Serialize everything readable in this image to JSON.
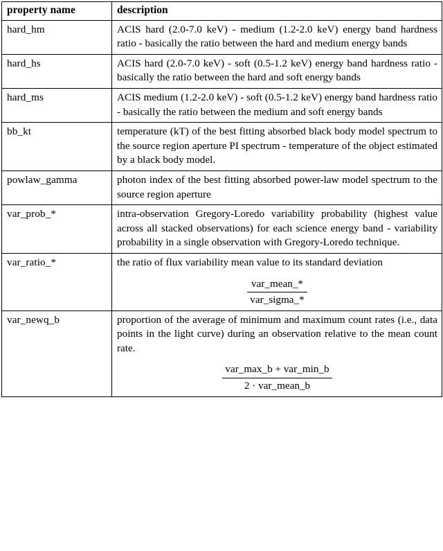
{
  "table": {
    "headers": {
      "property_name": "property name",
      "description": "description"
    },
    "rows": [
      {
        "name": "hard_hm",
        "description": "ACIS hard (2.0-7.0 keV) - medium (1.2-2.0 keV) energy band hardness ratio - basically the ratio between the hard and medium energy bands"
      },
      {
        "name": "hard_hs",
        "description": "ACIS hard (2.0-7.0 keV) - soft (0.5-1.2 keV) energy band hardness ratio - basically the ratio between the hard and soft energy bands"
      },
      {
        "name": "hard_ms",
        "description": "ACIS medium (1.2-2.0 keV) - soft (0.5-1.2 keV) energy band hardness ratio - basically the ratio between the medium and soft energy bands"
      },
      {
        "name": "bb_kt",
        "description": "temperature (kT) of the best fitting absorbed black body model spectrum to the source region aperture PI spectrum - temperature of the object estimated by a black body model."
      },
      {
        "name": "powlaw_gamma",
        "description": "photon index of the best fitting absorbed power-law model spectrum to the source region aperture"
      },
      {
        "name": "var_prob_*",
        "description": "intra-observation Gregory-Loredo variability probability (highest value across all stacked observations) for each science energy band - variability probability in a single observation with Gregory-Loredo technique."
      },
      {
        "name": "var_ratio_*",
        "description": "the ratio of flux variability mean value to its standard deviation",
        "formula": {
          "numerator": "var_mean_*",
          "denominator": "var_sigma_*"
        }
      },
      {
        "name": "var_newq_b",
        "description": "proportion of the average of minimum and maximum count rates (i.e., data points in the light curve) during an observation relative to the mean count rate.",
        "formula": {
          "numerator": "var_max_b + var_min_b",
          "denominator": "2 · var_mean_b"
        }
      }
    ]
  }
}
